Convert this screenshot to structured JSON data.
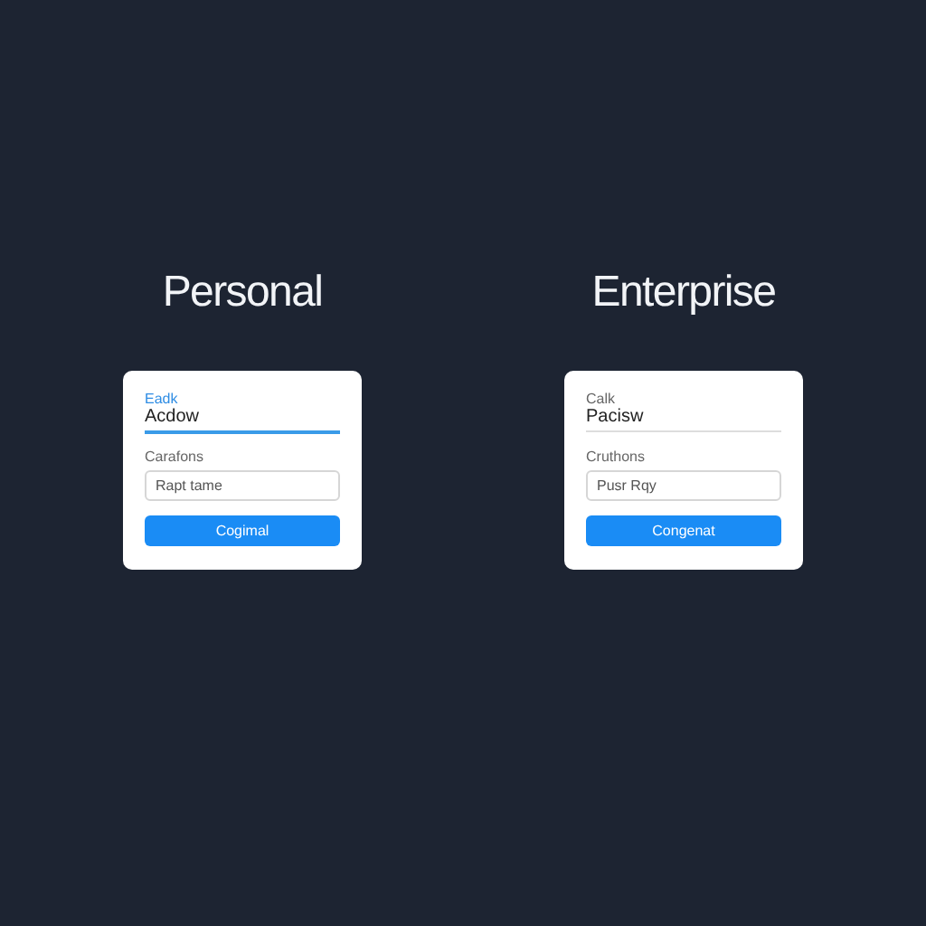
{
  "plans": [
    {
      "title": "Personal",
      "field": {
        "label": "Eadk",
        "value": "Acdow",
        "focused": true
      },
      "input": {
        "label": "Carafons",
        "placeholder": "Rapt tame"
      },
      "button": "Cogimal"
    },
    {
      "title": "Enterprise",
      "field": {
        "label": "Calk",
        "value": "Pacisw",
        "focused": false
      },
      "input": {
        "label": "Cruthons",
        "placeholder": "Pusr Rqy"
      },
      "button": "Congenat"
    }
  ]
}
